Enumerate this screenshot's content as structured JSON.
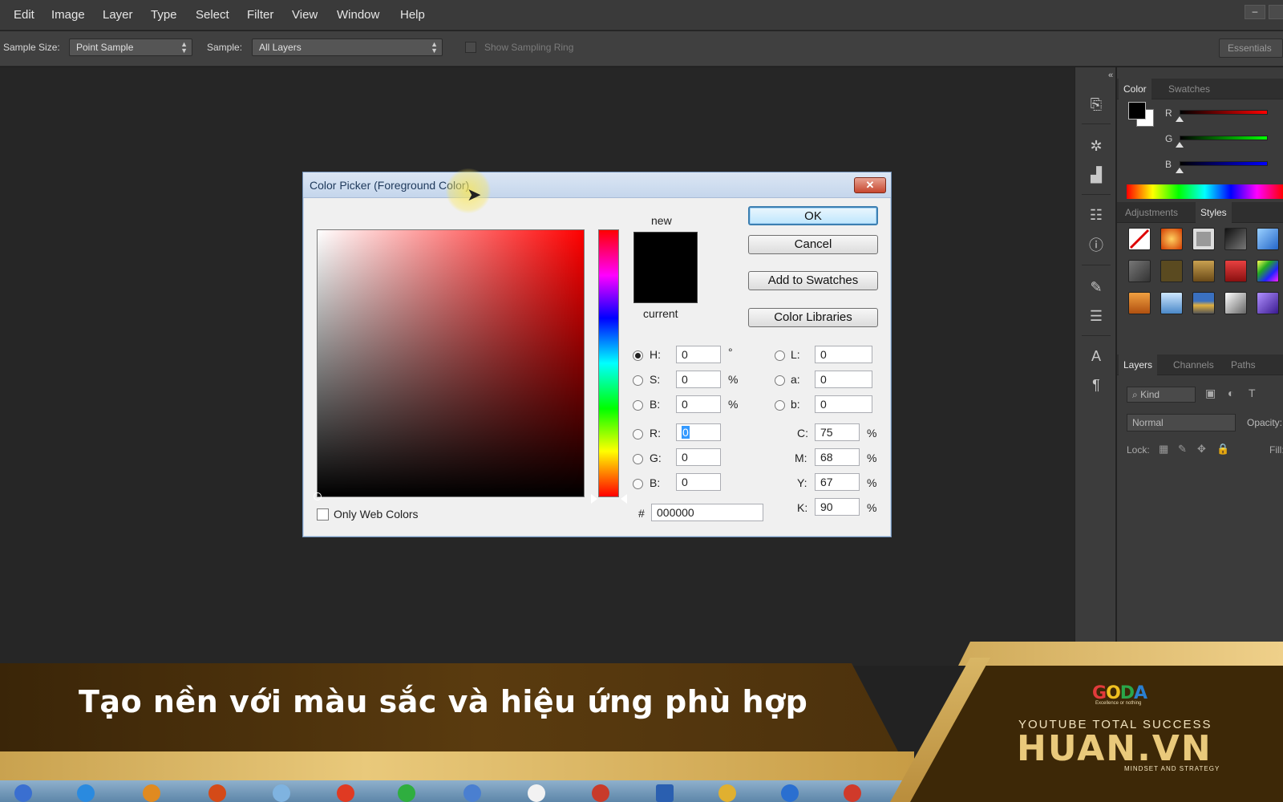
{
  "menu": {
    "items": [
      "Edit",
      "Image",
      "Layer",
      "Type",
      "Select",
      "Filter",
      "View",
      "Window",
      "Help"
    ],
    "minimize_icon": "minimize-icon"
  },
  "options_bar": {
    "sample_size_label": "Sample Size:",
    "sample_size_value": "Point Sample",
    "sample_label": "Sample:",
    "sample_value": "All Layers",
    "sampling_ring_label": "Show Sampling Ring",
    "sampling_ring_checked": false,
    "workspace_button": "Essentials"
  },
  "toolstrip": {
    "icons": [
      "history-icon",
      "brush-settings-icon",
      "histogram-icon",
      "properties-icon",
      "info-icon",
      "brushes-icon",
      "adjust-icon",
      "character-icon",
      "paragraph-icon"
    ]
  },
  "color_panel": {
    "tabs": [
      "Color",
      "Swatches"
    ],
    "active_tab": "Color",
    "sliders": [
      "R",
      "G",
      "B"
    ],
    "foreground": "#000000",
    "background": "#ffffff"
  },
  "styles_panel": {
    "tabs": [
      "Adjustments",
      "Styles"
    ],
    "active_tab": "Styles"
  },
  "layers_panel": {
    "tabs": [
      "Layers",
      "Channels",
      "Paths"
    ],
    "active_tab": "Layers",
    "filter_label": "Kind",
    "blend_mode": "Normal",
    "opacity_label": "Opacity:",
    "lock_label": "Lock:",
    "fill_label": "Fill:"
  },
  "dialog": {
    "title": "Color Picker (Foreground Color)",
    "close_label": "✕",
    "new_label": "new",
    "current_label": "current",
    "new_color": "#000000",
    "current_color": "#000000",
    "buttons": {
      "ok": "OK",
      "cancel": "Cancel",
      "add_to_swatches": "Add to Swatches",
      "color_libraries": "Color Libraries"
    },
    "hsb": [
      {
        "label": "H:",
        "value": "0",
        "unit": "°",
        "selected": true
      },
      {
        "label": "S:",
        "value": "0",
        "unit": "%",
        "selected": false
      },
      {
        "label": "B:",
        "value": "0",
        "unit": "%",
        "selected": false
      }
    ],
    "rgb": [
      {
        "label": "R:",
        "value": "0",
        "selected": false
      },
      {
        "label": "G:",
        "value": "0",
        "selected": false
      },
      {
        "label": "B:",
        "value": "0",
        "selected": false
      }
    ],
    "lab": [
      {
        "label": "L:",
        "value": "0"
      },
      {
        "label": "a:",
        "value": "0"
      },
      {
        "label": "b:",
        "value": "0"
      }
    ],
    "cmyk": [
      {
        "label": "C:",
        "value": "75",
        "unit": "%"
      },
      {
        "label": "M:",
        "value": "68",
        "unit": "%"
      },
      {
        "label": "Y:",
        "value": "67",
        "unit": "%"
      },
      {
        "label": "K:",
        "value": "90",
        "unit": "%"
      }
    ],
    "hex_label": "#",
    "hex_value": "000000",
    "only_web_colors_label": "Only Web Colors",
    "only_web_colors_checked": false
  },
  "banner": {
    "title": "Tạo nền với màu sắc và hiệu ứng phù hợp",
    "brand_logo": "GODA",
    "brand_tagline": "Excellence or nothing",
    "channel_line": "YOUTUBE TOTAL SUCCESS",
    "brand_name": "HUAN.VN",
    "brand_sub": "MINDSET AND STRATEGY"
  }
}
